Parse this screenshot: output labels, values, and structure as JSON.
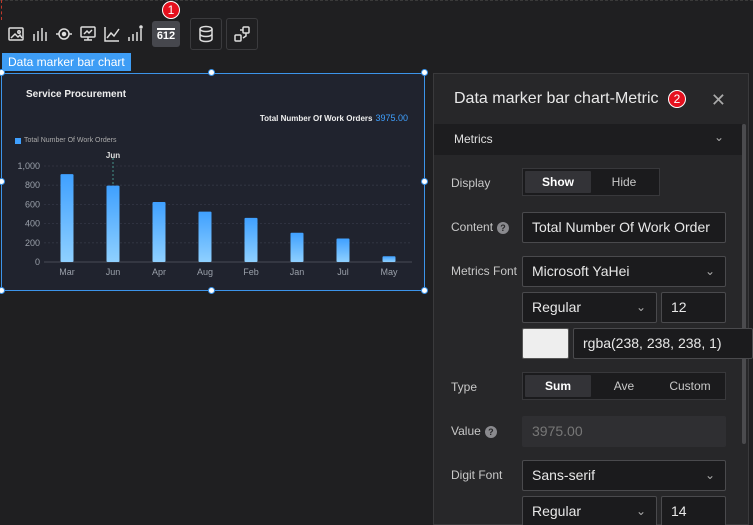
{
  "toolbar": {
    "tools": [
      "image-icon",
      "bar-chart-icon",
      "target-icon",
      "screen-icon",
      "line-chart-icon",
      "bar-chart-data-icon"
    ],
    "active_tool_text": "612",
    "step_badge_1": "1"
  },
  "widget": {
    "tab_label": "Data marker bar chart",
    "title": "Service Procurement",
    "metric_label": "Total Number Of Work Orders",
    "metric_value": "3975.00",
    "legend_label": "Total Number Of Work Orders",
    "tooltip_label": "Jun"
  },
  "chart_data": {
    "type": "bar",
    "title": "Service Procurement",
    "categories": [
      "Mar",
      "Jun",
      "Apr",
      "Aug",
      "Feb",
      "Jan",
      "Jul",
      "May"
    ],
    "series": [
      {
        "name": "Total Number Of Work Orders",
        "values": [
          915,
          795,
          625,
          525,
          460,
          305,
          245,
          60
        ]
      }
    ],
    "y_ticks": [
      "0",
      "200",
      "400",
      "600",
      "800",
      "1,000"
    ],
    "ylim": [
      0,
      1000
    ],
    "highlighted_category": "Jun",
    "bar_color": "#3fa0ff",
    "grid": true
  },
  "panel": {
    "title": "Data marker bar chart-Metric",
    "step_badge_2": "2",
    "section": "Metrics",
    "display_label": "Display",
    "display_options": [
      "Show",
      "Hide"
    ],
    "content_label": "Content",
    "content_value": "Total Number Of Work Order",
    "metrics_font_label": "Metrics Font",
    "metrics_font": "Microsoft YaHei",
    "metrics_weight": "Regular",
    "metrics_size": "12",
    "metrics_color": "rgba(238, 238, 238, 1)",
    "type_label": "Type",
    "type_options": [
      "Sum",
      "Ave",
      "Custom"
    ],
    "value_label": "Value",
    "value_placeholder": "3975.00",
    "digit_font_label": "Digit Font",
    "digit_font": "Sans-serif",
    "digit_weight": "Regular",
    "digit_size": "14"
  }
}
